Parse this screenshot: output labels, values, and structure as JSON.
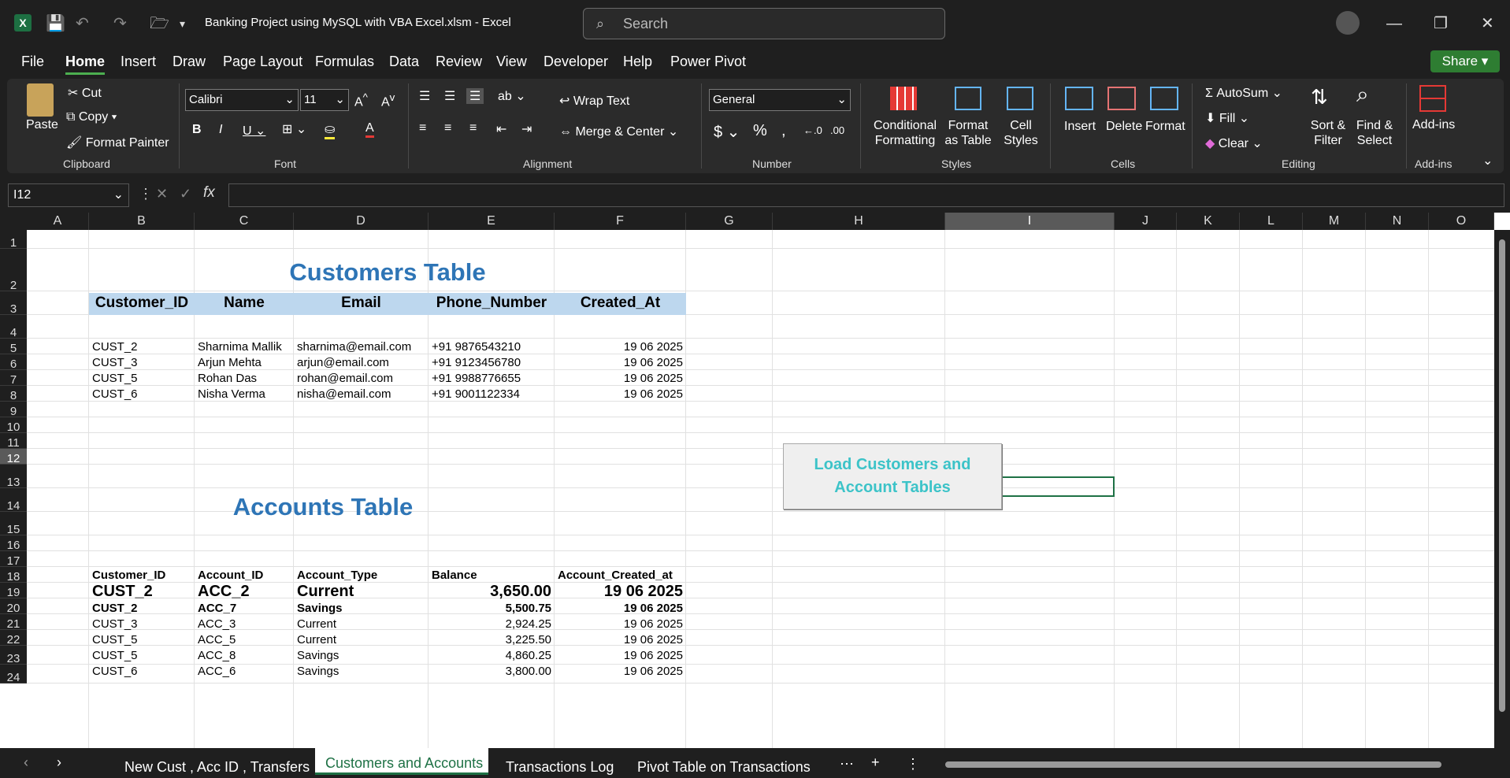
{
  "window": {
    "title": "Banking Project using MySQL with VBA Excel.xlsm  -  Excel",
    "search_placeholder": "Search"
  },
  "menu": [
    "File",
    "Home",
    "Insert",
    "Draw",
    "Page Layout",
    "Formulas",
    "Data",
    "Review",
    "View",
    "Developer",
    "Help",
    "Power Pivot"
  ],
  "share": "Share",
  "ribbon": {
    "clipboard": {
      "paste": "Paste",
      "cut": "Cut",
      "copy": "Copy",
      "format_painter": "Format Painter",
      "label": "Clipboard"
    },
    "font": {
      "name": "Calibri",
      "size": "11",
      "label": "Font"
    },
    "alignment": {
      "wrap": "Wrap Text",
      "merge": "Merge & Center",
      "label": "Alignment"
    },
    "number": {
      "format": "General",
      "label": "Number"
    },
    "styles": {
      "conditional": "Conditional Formatting",
      "format_table": "Format as Table",
      "cell_styles": "Cell Styles",
      "label": "Styles"
    },
    "cells": {
      "insert": "Insert",
      "delete": "Delete",
      "format": "Format",
      "label": "Cells"
    },
    "editing": {
      "autosum": "AutoSum",
      "fill": "Fill",
      "clear": "Clear",
      "sort": "Sort & Filter",
      "find": "Find & Select",
      "label": "Editing"
    },
    "addins": {
      "addins": "Add-ins",
      "label": "Add-ins"
    }
  },
  "namebox": "I12",
  "columns": [
    "A",
    "B",
    "C",
    "D",
    "E",
    "F",
    "G",
    "H",
    "I",
    "J",
    "K",
    "L",
    "M",
    "N",
    "O"
  ],
  "rows": [
    "1",
    "2",
    "3",
    "4",
    "5",
    "6",
    "7",
    "8",
    "9",
    "10",
    "11",
    "12",
    "13",
    "14",
    "15",
    "16",
    "17",
    "18",
    "19",
    "20",
    "21",
    "22",
    "23",
    "24"
  ],
  "customers": {
    "title": "Customers Table",
    "headers": [
      "Customer_ID",
      "Name",
      "Email",
      "Phone_Number",
      "Created_At"
    ],
    "rows": [
      [
        "CUST_2",
        "Sharnima Mallik",
        "sharnima@email.com",
        "+91 9876543210",
        "19 06 2025"
      ],
      [
        "CUST_3",
        "Arjun Mehta",
        "arjun@email.com",
        "+91 9123456780",
        "19 06 2025"
      ],
      [
        "CUST_5",
        "Rohan Das",
        "rohan@email.com",
        "+91 9988776655",
        "19 06 2025"
      ],
      [
        "CUST_6",
        "Nisha Verma",
        "nisha@email.com",
        "+91 9001122334",
        "19 06 2025"
      ]
    ]
  },
  "accounts": {
    "title": "Accounts Table",
    "headers": [
      "Customer_ID",
      "Account_ID",
      "Account_Type",
      "Balance",
      "Account_Created_at"
    ],
    "rows": [
      [
        "CUST_2",
        "ACC_2",
        "Current",
        "3,650.00",
        "19 06 2025"
      ],
      [
        "CUST_2",
        "ACC_7",
        "Savings",
        "5,500.75",
        "19 06 2025"
      ],
      [
        "CUST_3",
        "ACC_3",
        "Current",
        "2,924.25",
        "19 06 2025"
      ],
      [
        "CUST_5",
        "ACC_5",
        "Current",
        "3,225.50",
        "19 06 2025"
      ],
      [
        "CUST_5",
        "ACC_8",
        "Savings",
        "4,860.25",
        "19 06 2025"
      ],
      [
        "CUST_6",
        "ACC_6",
        "Savings",
        "3,800.00",
        "19 06 2025"
      ]
    ]
  },
  "load_button": "Load Customers and Account Tables",
  "sheets": [
    "New Cust , Acc ID , Transfers",
    "Customers and Accounts",
    "Transactions Log",
    "Pivot Table on Transactions"
  ]
}
